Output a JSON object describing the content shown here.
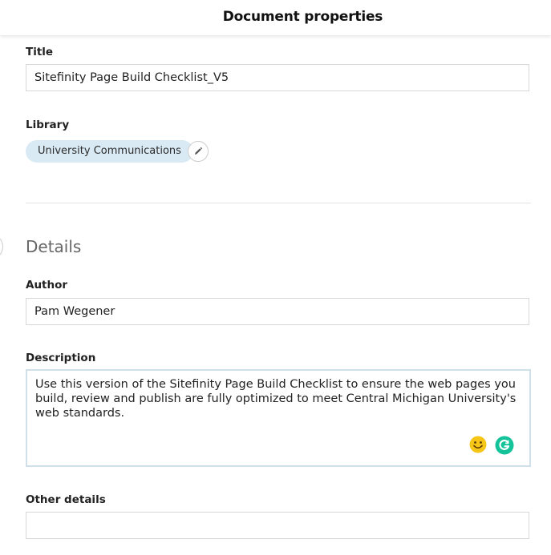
{
  "header": {
    "title": "Document properties"
  },
  "title_field": {
    "label": "Title",
    "value": "Sitefinity Page Build Checklist_V5"
  },
  "library": {
    "label": "Library",
    "chip": "University Communications",
    "edit_icon": "pencil-icon"
  },
  "details": {
    "heading": "Details",
    "author": {
      "label": "Author",
      "value": "Pam Wegener"
    },
    "description": {
      "label": "Description",
      "value": "Use this version of the Sitefinity Page Build Checklist to ensure the web pages you build, review and publish are fully optimized to meet Central Michigan University's web standards."
    },
    "other_details": {
      "label": "Other details",
      "value": ""
    }
  },
  "icons": {
    "emoji": "smiley-emoji-icon",
    "assistant": "grammarly-icon"
  },
  "colors": {
    "chip_bg": "#d9eaf5",
    "grammarly": "#15c39a",
    "emoji": "#f5c518"
  }
}
